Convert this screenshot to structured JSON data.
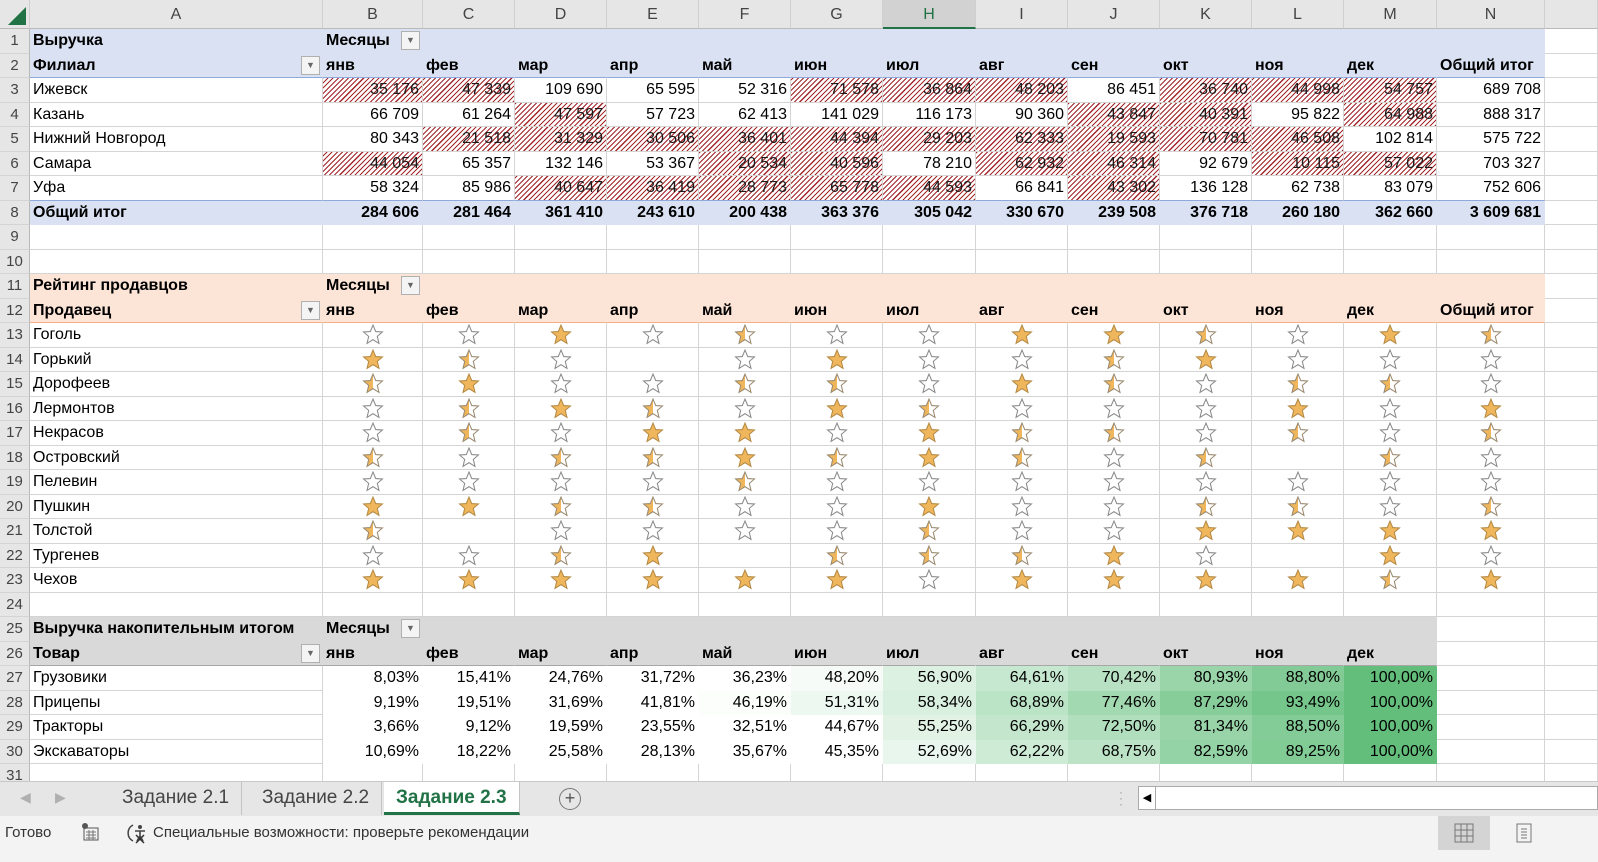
{
  "columns": [
    "A",
    "B",
    "C",
    "D",
    "E",
    "F",
    "G",
    "H",
    "I",
    "J",
    "K",
    "L",
    "M",
    "N"
  ],
  "selected_column": "H",
  "revenue": {
    "title": "Выручка",
    "filter_label": "Месяцы",
    "row_label": "Филиал",
    "months": [
      "янв",
      "фев",
      "мар",
      "апр",
      "май",
      "июн",
      "июл",
      "авг",
      "сен",
      "окт",
      "ноя",
      "дек"
    ],
    "total_label": "Общий итог",
    "rows": [
      {
        "name": "Ижевск",
        "values": [
          "35 176",
          "47 339",
          "109 690",
          "65 595",
          "52 316",
          "71 578",
          "36 864",
          "48 203",
          "86 451",
          "36 740",
          "44 998",
          "54 757"
        ],
        "total": "689 708",
        "hatched": [
          0,
          1,
          5,
          6,
          7,
          9,
          10,
          11
        ]
      },
      {
        "name": "Казань",
        "values": [
          "66 709",
          "61 264",
          "47 597",
          "57 723",
          "62 413",
          "141 029",
          "116 173",
          "90 360",
          "43 847",
          "40 391",
          "95 822",
          "64 988"
        ],
        "total": "888 317",
        "hatched": [
          2,
          8,
          9,
          11
        ]
      },
      {
        "name": "Нижний Новгород",
        "values": [
          "80 343",
          "21 518",
          "31 329",
          "30 506",
          "36 401",
          "44 394",
          "29 203",
          "62 333",
          "19 593",
          "70 781",
          "46 508",
          "102 814"
        ],
        "total": "575 722",
        "hatched": [
          1,
          2,
          3,
          4,
          5,
          6,
          7,
          8,
          9,
          10
        ]
      },
      {
        "name": "Самара",
        "values": [
          "44 054",
          "65 357",
          "132 146",
          "53 367",
          "20 534",
          "40 596",
          "78 210",
          "62 932",
          "46 314",
          "92 679",
          "10 115",
          "57 022"
        ],
        "total": "703 327",
        "hatched": [
          0,
          4,
          5,
          7,
          8,
          10,
          11
        ]
      },
      {
        "name": "Уфа",
        "values": [
          "58 324",
          "85 986",
          "40 647",
          "36 419",
          "28 773",
          "65 778",
          "44 593",
          "66 841",
          "43 302",
          "136 128",
          "62 738",
          "83 079"
        ],
        "total": "752 606",
        "hatched": [
          2,
          3,
          4,
          5,
          6,
          8
        ]
      }
    ],
    "grand_total": {
      "label": "Общий итог",
      "values": [
        "284 606",
        "281 464",
        "361 410",
        "243 610",
        "200 438",
        "363 376",
        "305 042",
        "330 670",
        "239 508",
        "376 718",
        "260 180",
        "362 660"
      ],
      "total": "3 609 681"
    }
  },
  "ratings": {
    "title": "Рейтинг продавцов",
    "filter_label": "Месяцы",
    "row_label": "Продавец",
    "months": [
      "янв",
      "фев",
      "мар",
      "апр",
      "май",
      "июн",
      "июл",
      "авг",
      "сен",
      "окт",
      "ноя",
      "дек"
    ],
    "total_label": "Общий итог",
    "rows": [
      {
        "name": "Гоголь",
        "ratings": [
          "empty",
          "empty",
          "full",
          "empty",
          "half",
          "empty",
          "empty",
          "full",
          "full",
          "half",
          "empty",
          "full",
          "half"
        ]
      },
      {
        "name": "Горький",
        "ratings": [
          "full",
          "half",
          "empty",
          "",
          "empty",
          "full",
          "empty",
          "empty",
          "half",
          "full",
          "empty",
          "empty",
          "empty"
        ]
      },
      {
        "name": "Дорофеев",
        "ratings": [
          "half",
          "full",
          "empty",
          "empty",
          "half",
          "half",
          "empty",
          "full",
          "half",
          "empty",
          "half",
          "half",
          "empty"
        ]
      },
      {
        "name": "Лермонтов",
        "ratings": [
          "empty",
          "half",
          "full",
          "half",
          "empty",
          "full",
          "half",
          "empty",
          "empty",
          "empty",
          "full",
          "empty",
          "full"
        ]
      },
      {
        "name": "Некрасов",
        "ratings": [
          "empty",
          "half",
          "empty",
          "full",
          "full",
          "empty",
          "full",
          "half",
          "half",
          "empty",
          "half",
          "empty",
          "half"
        ]
      },
      {
        "name": "Островский",
        "ratings": [
          "half",
          "empty",
          "half",
          "half",
          "full",
          "half",
          "full",
          "half",
          "empty",
          "half",
          "",
          "half",
          "empty"
        ]
      },
      {
        "name": "Пелевин",
        "ratings": [
          "empty",
          "empty",
          "empty",
          "empty",
          "half",
          "empty",
          "empty",
          "empty",
          "empty",
          "empty",
          "empty",
          "empty",
          "empty"
        ]
      },
      {
        "name": "Пушкин",
        "ratings": [
          "full",
          "full",
          "half",
          "half",
          "empty",
          "empty",
          "full",
          "empty",
          "empty",
          "half",
          "half",
          "empty",
          "half"
        ]
      },
      {
        "name": "Толстой",
        "ratings": [
          "half",
          "",
          "empty",
          "empty",
          "empty",
          "empty",
          "half",
          "empty",
          "empty",
          "full",
          "full",
          "full",
          "full"
        ]
      },
      {
        "name": "Тургенев",
        "ratings": [
          "empty",
          "empty",
          "half",
          "full",
          "",
          "half",
          "half",
          "half",
          "full",
          "empty",
          "",
          "full",
          "empty"
        ]
      },
      {
        "name": "Чехов",
        "ratings": [
          "full",
          "full",
          "full",
          "full",
          "full",
          "full",
          "empty",
          "full",
          "full",
          "full",
          "full",
          "half",
          "full"
        ]
      }
    ]
  },
  "cumulative": {
    "title": "Выручка накопительным итогом",
    "filter_label": "Месяцы",
    "row_label": "Товар",
    "months": [
      "янв",
      "фев",
      "мар",
      "апр",
      "май",
      "июн",
      "июл",
      "авг",
      "сен",
      "окт",
      "ноя",
      "дек"
    ],
    "rows": [
      {
        "name": "Грузовики",
        "values": [
          "8,03%",
          "15,41%",
          "24,76%",
          "31,72%",
          "36,23%",
          "48,20%",
          "56,90%",
          "64,61%",
          "70,42%",
          "80,93%",
          "88,80%",
          "100,00%"
        ]
      },
      {
        "name": "Прицепы",
        "values": [
          "9,19%",
          "19,51%",
          "31,69%",
          "41,81%",
          "46,19%",
          "51,31%",
          "58,34%",
          "68,89%",
          "77,46%",
          "87,29%",
          "93,49%",
          "100,00%"
        ]
      },
      {
        "name": "Тракторы",
        "values": [
          "3,66%",
          "9,12%",
          "19,59%",
          "23,55%",
          "32,51%",
          "44,67%",
          "55,25%",
          "66,29%",
          "72,50%",
          "81,34%",
          "88,50%",
          "100,00%"
        ]
      },
      {
        "name": "Экскаваторы",
        "values": [
          "10,69%",
          "18,22%",
          "25,58%",
          "28,13%",
          "35,67%",
          "45,35%",
          "52,69%",
          "62,22%",
          "68,75%",
          "82,59%",
          "89,25%",
          "100,00%"
        ]
      }
    ]
  },
  "sheet_tabs": [
    "Задание 2.1",
    "Задание 2.2",
    "Задание 2.3"
  ],
  "active_sheet": 2,
  "status": {
    "ready": "Готово",
    "accessibility": "Специальные возможности: проверьте рекомендации"
  },
  "colors": {
    "accent": "#217346",
    "hatch": "#a3262a",
    "star": "#efb65c",
    "scale_max": "#63be7b",
    "band_blue": "#d9e1f2",
    "band_peach": "#fce4d6",
    "band_gray": "#d9d9d9"
  }
}
